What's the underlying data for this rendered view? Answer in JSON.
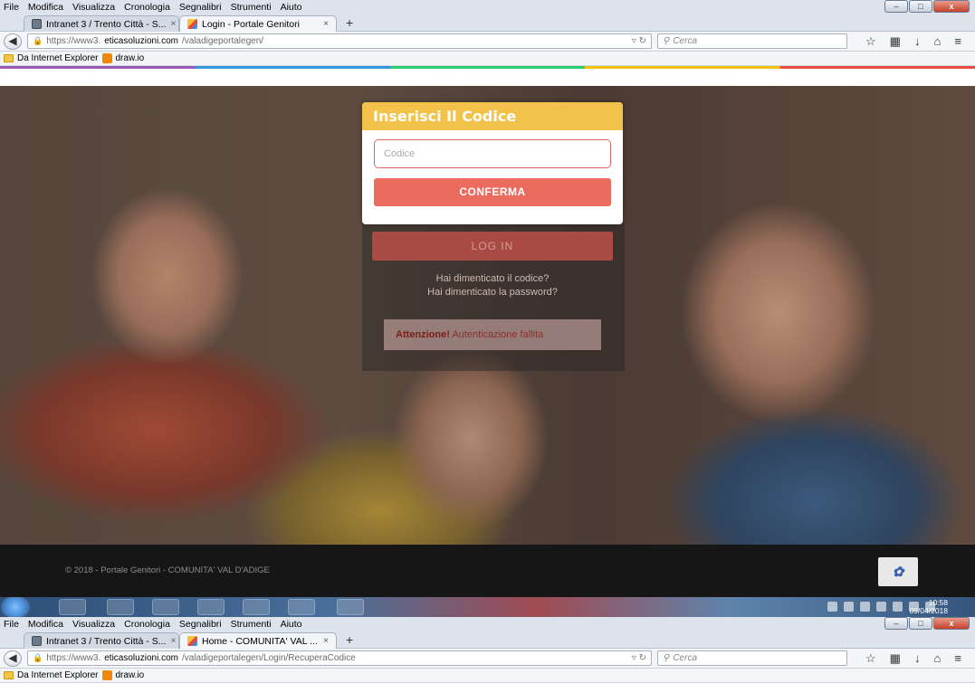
{
  "menu": [
    "File",
    "Modifica",
    "Visualizza",
    "Cronologia",
    "Segnalibri",
    "Strumenti",
    "Aiuto"
  ],
  "window_controls": {
    "minimize": "–",
    "maximize": "□",
    "close": "x"
  },
  "tabs1": [
    {
      "label": "Intranet 3 / Trento Città - S...",
      "close": "×"
    },
    {
      "label": "Login - Portale Genitori",
      "close": "×"
    }
  ],
  "tabs2": [
    {
      "label": "Intranet 3 / Trento Città - S...",
      "close": "×"
    },
    {
      "label": "Home - COMUNITA' VAL ...",
      "close": "×"
    }
  ],
  "newtab": "+",
  "url1": {
    "prefix": "https://www3.",
    "host": "eticasoluzioni.com",
    "path": "/valadigeportalegen/"
  },
  "url2": {
    "prefix": "https://www3.",
    "host": "eticasoluzioni.com",
    "path": "/valadigeportalegen/Login/RecuperaCodice"
  },
  "search_placeholder": "Cerca",
  "bookmarks": [
    "Da Internet Explorer",
    "draw.io"
  ],
  "card": {
    "title": "Inserisci Il Codice",
    "input_placeholder": "Codice",
    "button": "CONFERMA"
  },
  "login": {
    "button": "LOG IN",
    "forgot_code": "Hai dimenticato il codice?",
    "forgot_password": "Hai dimenticato la password?"
  },
  "alert": {
    "strong": "Attenzione!",
    "text": "Autenticazione fallita"
  },
  "footer": {
    "copyright": "© 2018 - Portale Genitori - COMUNITA' VAL D'ADIGE"
  },
  "taskbar": {
    "time": "10:58",
    "date": "09/04/2018"
  },
  "colors": {
    "card_header": "#f2c24a",
    "button": "#ec6b5f",
    "footer": "#161616"
  }
}
